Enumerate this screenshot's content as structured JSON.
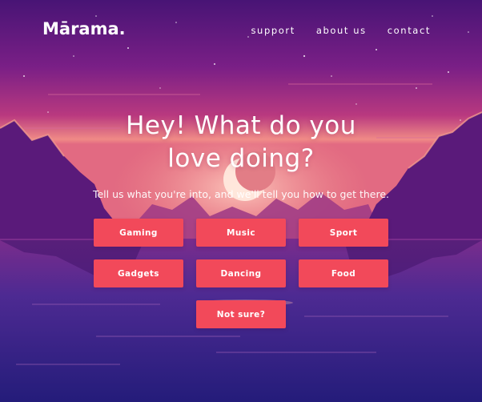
{
  "brand": {
    "logo_text": "Mārama."
  },
  "nav": [
    {
      "label": "support"
    },
    {
      "label": "about us"
    },
    {
      "label": "contact"
    }
  ],
  "hero": {
    "headline_line1": "Hey! What do you",
    "headline_line2": "love doing?",
    "subhead": "Tell us what you're into, and we'll tell you how to get there."
  },
  "options": [
    {
      "label": "Gaming"
    },
    {
      "label": "Music"
    },
    {
      "label": "Sport"
    },
    {
      "label": "Gadgets"
    },
    {
      "label": "Dancing"
    },
    {
      "label": "Food"
    },
    {
      "label": "Not sure?"
    }
  ],
  "colors": {
    "sky_top": "#4a1478",
    "sky_mid": "#b3387f",
    "horizon": "#f4757c",
    "water": "#2b1f82",
    "button": "#f2495a"
  }
}
